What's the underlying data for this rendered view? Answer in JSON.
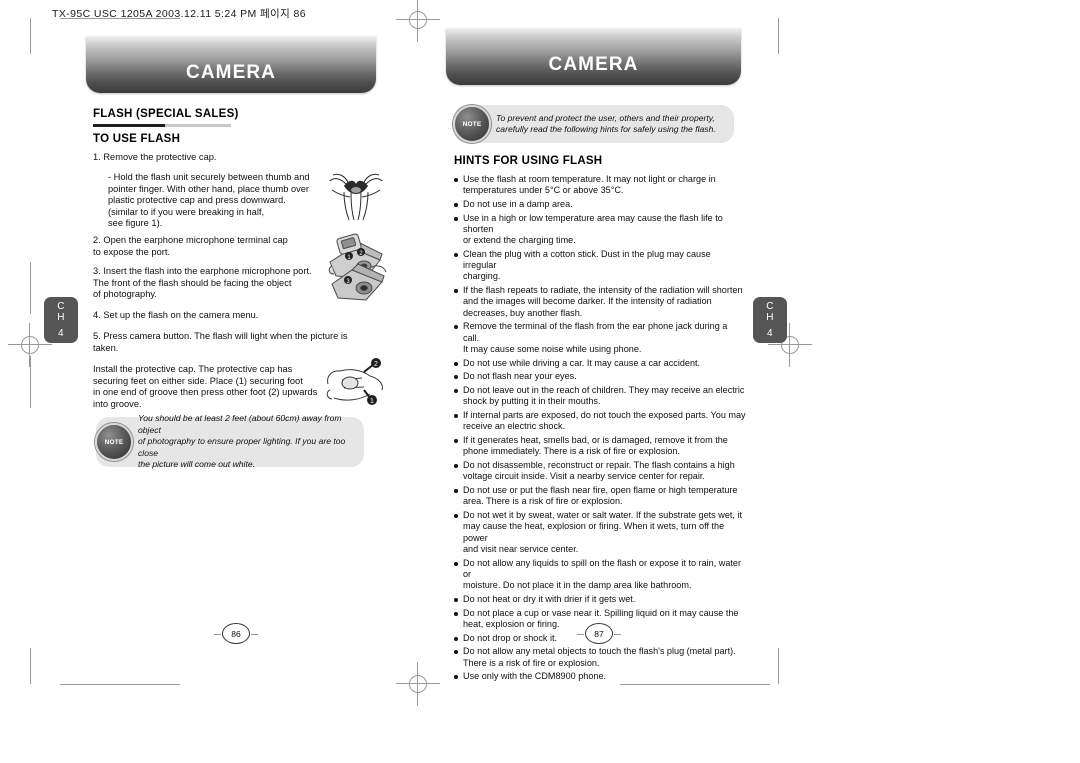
{
  "scan_header": "TX-95C USC 1205A  2003.12.11 5:24 PM  페이지 86",
  "left_page": {
    "banner": "CAMERA",
    "section_title": "FLASH (SPECIAL SALES)",
    "subsection_title": "TO USE FLASH",
    "step1": "1. Remove the protective cap.",
    "step1_detail": "- Hold the flash unit securely between thumb and\n  pointer finger. With other hand, place thumb over\n  plastic protective cap and press downward.\n  (similar to if you were breaking in half,\n   see figure 1).",
    "step2": "2. Open the earphone microphone terminal cap\n    to expose the port.",
    "step3": "3. Insert the flash into the earphone microphone port.\n    The front of the flash should be facing the object\n    of photography.",
    "step4": "4. Set up the flash on the camera menu.",
    "step5": "5. Press camera button.  The flash will light when the picture is\n    taken.",
    "closing_paragraph": "Install the protective cap. The protective cap has\nsecuring feet on either side. Place (1) securing foot\nin one end of groove then press other foot (2) upwards\ninto groove.",
    "note_badge": "NOTE",
    "note_text": "You should be at least 2 feet (about 60cm) away from object\nof photography to ensure proper lighting. If you are too close\nthe picture will come out white.",
    "chapter_tab": {
      "chapter": "C\nH",
      "number": "4"
    },
    "page_number": "86"
  },
  "right_page": {
    "banner": "CAMERA",
    "note_badge": "NOTE",
    "note_text": "To prevent and protect the user, others and their property,\ncarefully read the following hints for safely using the flash.",
    "section_title": "HINTS FOR USING FLASH",
    "bullets": [
      "Use the flash at room temperature.  It may not light or charge in\ntemperatures under 5°C or above 35°C.",
      "Do not use in a damp area.",
      "Use in a high or low temperature area may cause the flash life to shorten\nor extend the charging time.",
      "Clean the plug with a cotton stick. Dust in the plug may cause irregular\ncharging.",
      "If the flash repeats to radiate, the intensity of the radiation will shorten\nand the images will become darker. If the intensity of radiation\ndecreases, buy another flash.",
      "Remove the terminal of the flash from the ear phone jack during a call.\nIt may cause some noise while using phone.",
      "Do not use while driving a car. It may cause a car accident.",
      "Do not flash near your eyes.",
      "Do not leave out in the reach of children. They may receive an electric\nshock by putting it in their mouths.",
      "If internal parts are exposed, do not touch the exposed parts. You may\nreceive an electric shock.",
      "If it generates heat, smells bad, or is damaged, remove it from the\nphone immediately.  There is a risk of fire or explosion.",
      "Do not disassemble, reconstruct or repair.  The flash contains a high\nvoltage circuit inside. Visit a nearby service center for repair.",
      "Do not use or put the flash near fire, open flame or high temperature\narea. There is a risk of fire or explosion.",
      "Do not wet it by sweat, water or salt water. If the substrate gets wet, it\nmay cause the heat, explosion or firing. When it wets, turn off the power\nand visit near service center.",
      "Do not allow any liquids to spill on the flash or expose it to rain, water or\nmoisture. Do not place it in the damp area like bathroom.",
      "Do not heat or dry it with drier if it gets wet.",
      "Do not place a cup or vase near it. Spilling liquid on it may cause the\nheat, explosion or firing.",
      "Do not drop or shock it.",
      "Do not allow any metal objects to touch the flash's plug (metal part).\nThere is a risk of fire or explosion.",
      "Use only with the CDM8900 phone."
    ],
    "chapter_tab": {
      "chapter": "C\nH",
      "number": "4"
    },
    "page_number": "87"
  },
  "illustrations": {
    "hands_breaking_cap": "hands-breaking-cap-illustration",
    "phone_terminal_cap": "phone-terminal-cap-illustration",
    "insert_flash": "insert-flash-illustration",
    "install_cap": "install-protective-cap-illustration"
  },
  "colors": {
    "banner_dark": "#3c3c3c",
    "banner_light": "#f2f2f2",
    "note_bg": "#e6e6e6",
    "tab_gray": "#555555",
    "mark_gray": "#9a9a9a"
  }
}
